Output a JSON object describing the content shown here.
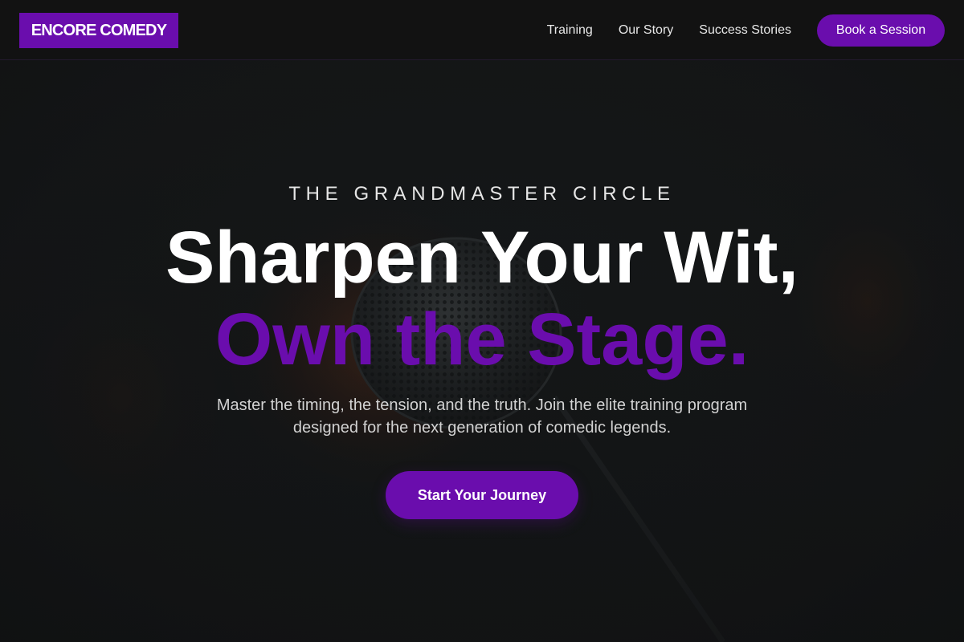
{
  "colors": {
    "brand": "#6a0dad",
    "nav_bg": "#121212",
    "hero_bg": "#161819",
    "text_primary": "#ffffff",
    "text_secondary": "#d2d2d2"
  },
  "nav": {
    "logo": "ENCORE COMEDY",
    "links": [
      "Training",
      "Our Story",
      "Success Stories"
    ],
    "cta_label": "Book a Session"
  },
  "hero": {
    "eyebrow": "THE GRANDMASTER CIRCLE",
    "headline_line1": "Sharpen Your Wit,",
    "headline_line2": "Own the Stage.",
    "subtext": "Master the timing, the tension, and the truth. Join the elite training program designed for the next generation of comedic legends.",
    "cta_label": "Start Your Journey",
    "background_image": "microphone-stage-photo"
  }
}
